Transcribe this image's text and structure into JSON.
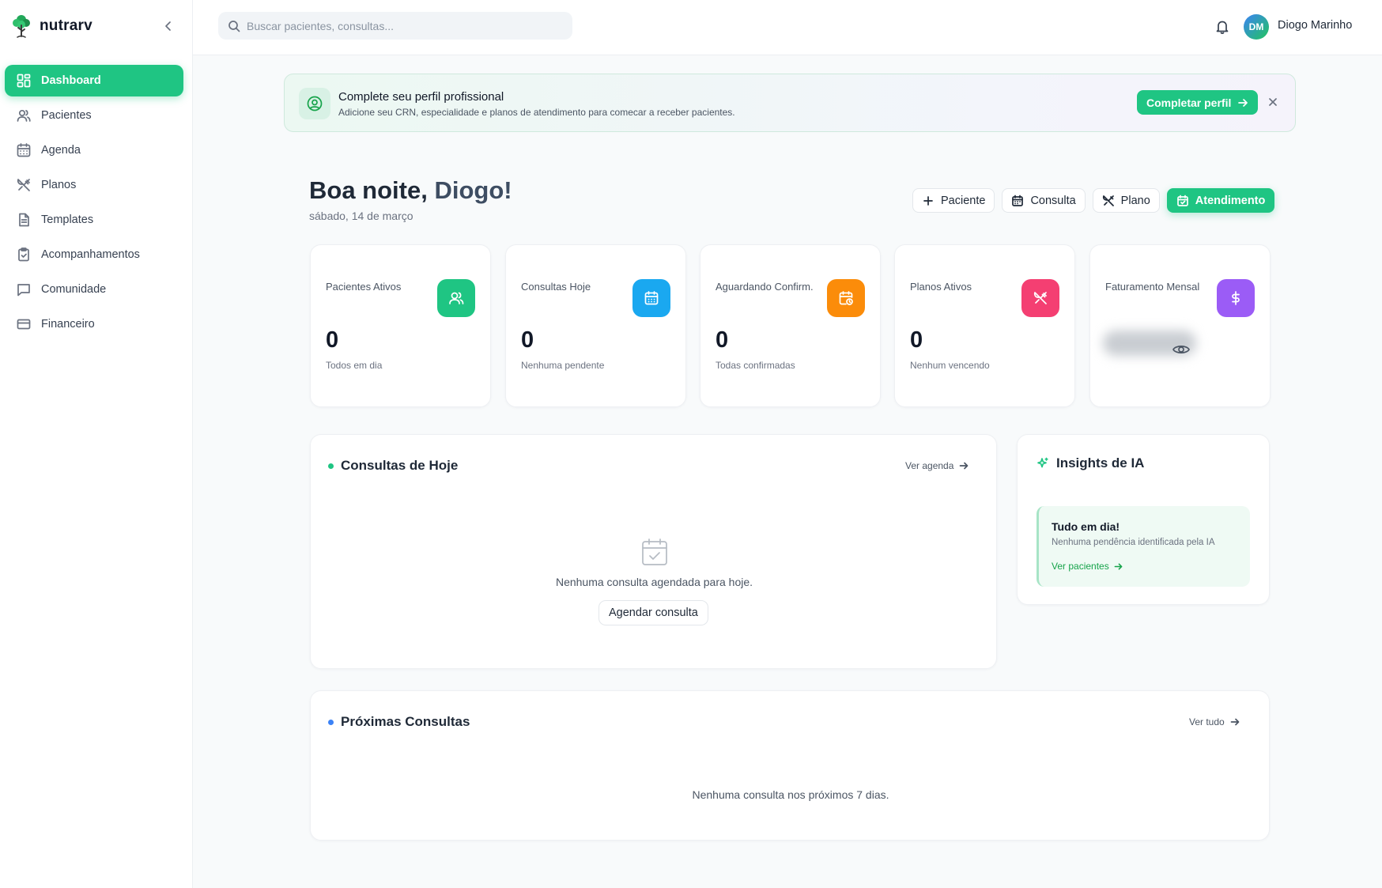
{
  "brand": {
    "name": "nutrarv",
    "logo_icon": "tree-logo-icon",
    "accent": "#1fc583"
  },
  "sidebar": {
    "items": [
      {
        "label": "Dashboard",
        "icon": "dashboard-icon",
        "active": true
      },
      {
        "label": "Pacientes",
        "icon": "users-icon"
      },
      {
        "label": "Agenda",
        "icon": "calendar-icon"
      },
      {
        "label": "Planos",
        "icon": "utensils-icon"
      },
      {
        "label": "Templates",
        "icon": "file-text-icon"
      },
      {
        "label": "Acompanhamentos",
        "icon": "clipboard-check-icon"
      },
      {
        "label": "Comunidade",
        "icon": "message-square-icon"
      },
      {
        "label": "Financeiro",
        "icon": "credit-card-icon"
      }
    ]
  },
  "topbar": {
    "search_placeholder": "Buscar pacientes, consultas...",
    "user_initials": "DM",
    "user_name": "Diogo Marinho"
  },
  "banner": {
    "title": "Complete seu perfil profissional",
    "subtitle": "Adicione seu CRN, especialidade e planos de atendimento para comecar a receber pacientes.",
    "button": "Completar perfil"
  },
  "greeting": {
    "prefix": "Boa noite, ",
    "name": "Diogo!",
    "date": "sábado, 14 de março"
  },
  "actions": {
    "paciente": "Paciente",
    "consulta": "Consulta",
    "plano": "Plano",
    "atendimento": "Atendimento"
  },
  "stats": [
    {
      "label": "Pacientes Ativos",
      "value": "0",
      "sub": "Todos em dia",
      "color": "#1fc583",
      "icon": "users-icon"
    },
    {
      "label": "Consultas Hoje",
      "value": "0",
      "sub": "Nenhuma pendente",
      "color": "#1aa8f0",
      "icon": "calendar-icon"
    },
    {
      "label": "Aguardando Confirm.",
      "value": "0",
      "sub": "Todas confirmadas",
      "color": "#fb8c0a",
      "icon": "calendar-clock-icon"
    },
    {
      "label": "Planos Ativos",
      "value": "0",
      "sub": "Nenhum vencendo",
      "color": "#f43f72",
      "icon": "utensils-icon"
    },
    {
      "label": "Faturamento Mensal",
      "color": "#9b5cf6",
      "icon": "dollar-icon",
      "hidden": true
    }
  ],
  "today": {
    "title": "Consultas de Hoje",
    "link": "Ver agenda",
    "empty": "Nenhuma consulta agendada para hoje.",
    "button": "Agendar consulta",
    "dot_color": "#1fc583"
  },
  "insights": {
    "title": "Insights de IA",
    "card_title": "Tudo em dia!",
    "card_sub": "Nenhuma pendência identificada pela IA",
    "card_link": "Ver pacientes"
  },
  "upcoming": {
    "title": "Próximas Consultas",
    "link": "Ver tudo",
    "empty": "Nenhuma consulta nos próximos 7 dias.",
    "dot_color": "#3b82f6"
  }
}
